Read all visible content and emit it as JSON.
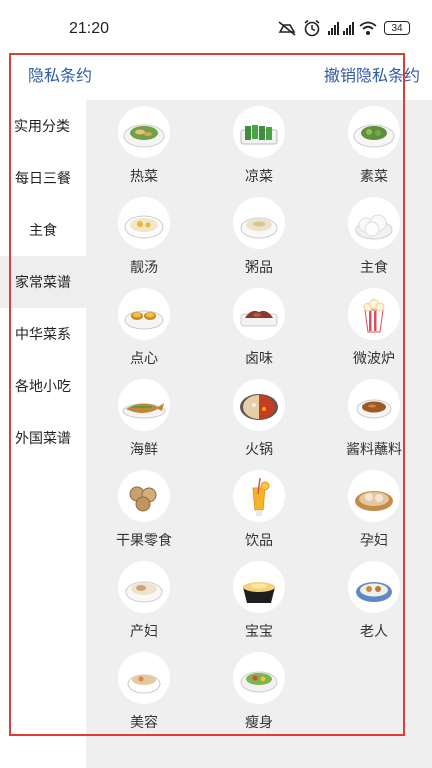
{
  "status": {
    "time": "21:20",
    "battery": "34"
  },
  "header": {
    "left_link": "隐私条约",
    "right_link": "撤销隐私条约"
  },
  "sidebar": {
    "items": [
      {
        "label": "实用分类"
      },
      {
        "label": "每日三餐"
      },
      {
        "label": "主食"
      },
      {
        "label": "家常菜谱"
      },
      {
        "label": "中华菜系"
      },
      {
        "label": "各地小吃"
      },
      {
        "label": "外国菜谱"
      }
    ],
    "active_index": 3
  },
  "grid": {
    "items": [
      {
        "label": "热菜",
        "icon": "hot-dish-icon"
      },
      {
        "label": "凉菜",
        "icon": "cold-dish-icon"
      },
      {
        "label": "素菜",
        "icon": "vegetable-dish-icon"
      },
      {
        "label": "靓汤",
        "icon": "soup-icon"
      },
      {
        "label": "粥品",
        "icon": "porridge-icon"
      },
      {
        "label": "主食",
        "icon": "staple-food-icon"
      },
      {
        "label": "点心",
        "icon": "dim-sum-icon"
      },
      {
        "label": "卤味",
        "icon": "braised-meat-icon"
      },
      {
        "label": "微波炉",
        "icon": "microwave-popcorn-icon"
      },
      {
        "label": "海鲜",
        "icon": "seafood-icon"
      },
      {
        "label": "火锅",
        "icon": "hotpot-icon"
      },
      {
        "label": "酱料蘸料",
        "icon": "sauce-icon"
      },
      {
        "label": "干果零食",
        "icon": "nuts-snack-icon"
      },
      {
        "label": "饮品",
        "icon": "drink-icon"
      },
      {
        "label": "孕妇",
        "icon": "pregnancy-dish-icon"
      },
      {
        "label": "产妇",
        "icon": "postpartum-dish-icon"
      },
      {
        "label": "宝宝",
        "icon": "baby-food-icon"
      },
      {
        "label": "老人",
        "icon": "elderly-dish-icon"
      },
      {
        "label": "美容",
        "icon": "beauty-dish-icon"
      },
      {
        "label": "瘦身",
        "icon": "slimming-dish-icon"
      }
    ]
  }
}
